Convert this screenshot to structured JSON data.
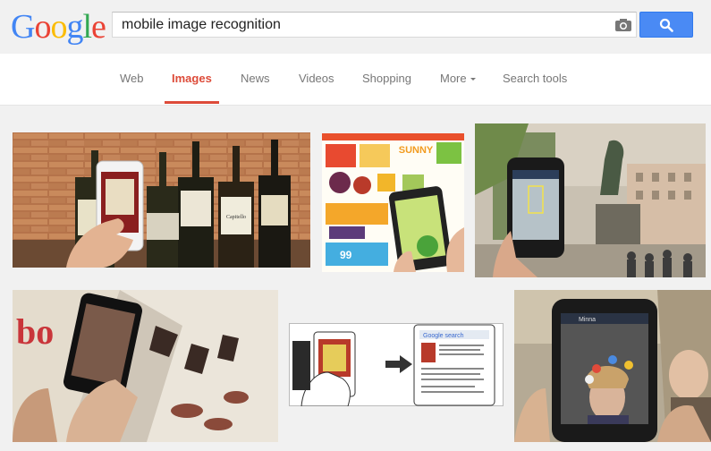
{
  "logo": {
    "letters": [
      "G",
      "o",
      "o",
      "g",
      "l",
      "e"
    ],
    "colors": [
      "#4285f4",
      "#ea4335",
      "#fbbc05",
      "#4285f4",
      "#34a853",
      "#ea4335"
    ]
  },
  "search": {
    "query": "mobile image recognition"
  },
  "tabs": [
    {
      "label": "Web"
    },
    {
      "label": "Images",
      "active": true
    },
    {
      "label": "News"
    },
    {
      "label": "Videos"
    },
    {
      "label": "Shopping"
    },
    {
      "label": "More"
    },
    {
      "label": "Search tools"
    }
  ],
  "colors": {
    "accent": "#dd4b39",
    "search_button": "#4a8af4",
    "background": "#f1f1f1"
  },
  "results": [
    {
      "subject": "phone scanning wine bottles",
      "icon": "image-thumb"
    },
    {
      "subject": "grocery flyer with phone",
      "icon": "image-thumb"
    },
    {
      "subject": "phone viewing statue in square",
      "icon": "image-thumb"
    },
    {
      "subject": "phone photographing magazine",
      "icon": "image-thumb"
    },
    {
      "subject": "phone recognizing book cover diagram",
      "icon": "image-thumb"
    },
    {
      "subject": "phone camera on person",
      "icon": "image-thumb"
    }
  ],
  "thumb_text": {
    "sunny": "SUNNY",
    "wine_label": "Capitello",
    "diagram_header": "Google search",
    "phone_title": "Minna"
  }
}
